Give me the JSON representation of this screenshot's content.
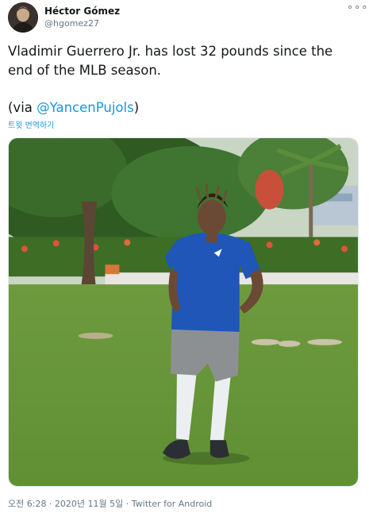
{
  "author": {
    "display_name": "Héctor Gómez",
    "handle": "@hgomez27",
    "more_icon": "more-horizontal-icon"
  },
  "tweet": {
    "text": "Vladimir Guerrero Jr. has lost 32 pounds since the end of the MLB season.",
    "via_prefix": "(via ",
    "mention": "@YancenPujols",
    "via_suffix": ")",
    "translate_label": "트윗 번역하기",
    "media_icon": "photo-icon"
  },
  "meta": {
    "timestamp": "오전 6:28 · 2020년 11월 5일 · Twitter for Android"
  },
  "colors": {
    "link": "#1b95e0",
    "secondary_text": "#657786"
  }
}
